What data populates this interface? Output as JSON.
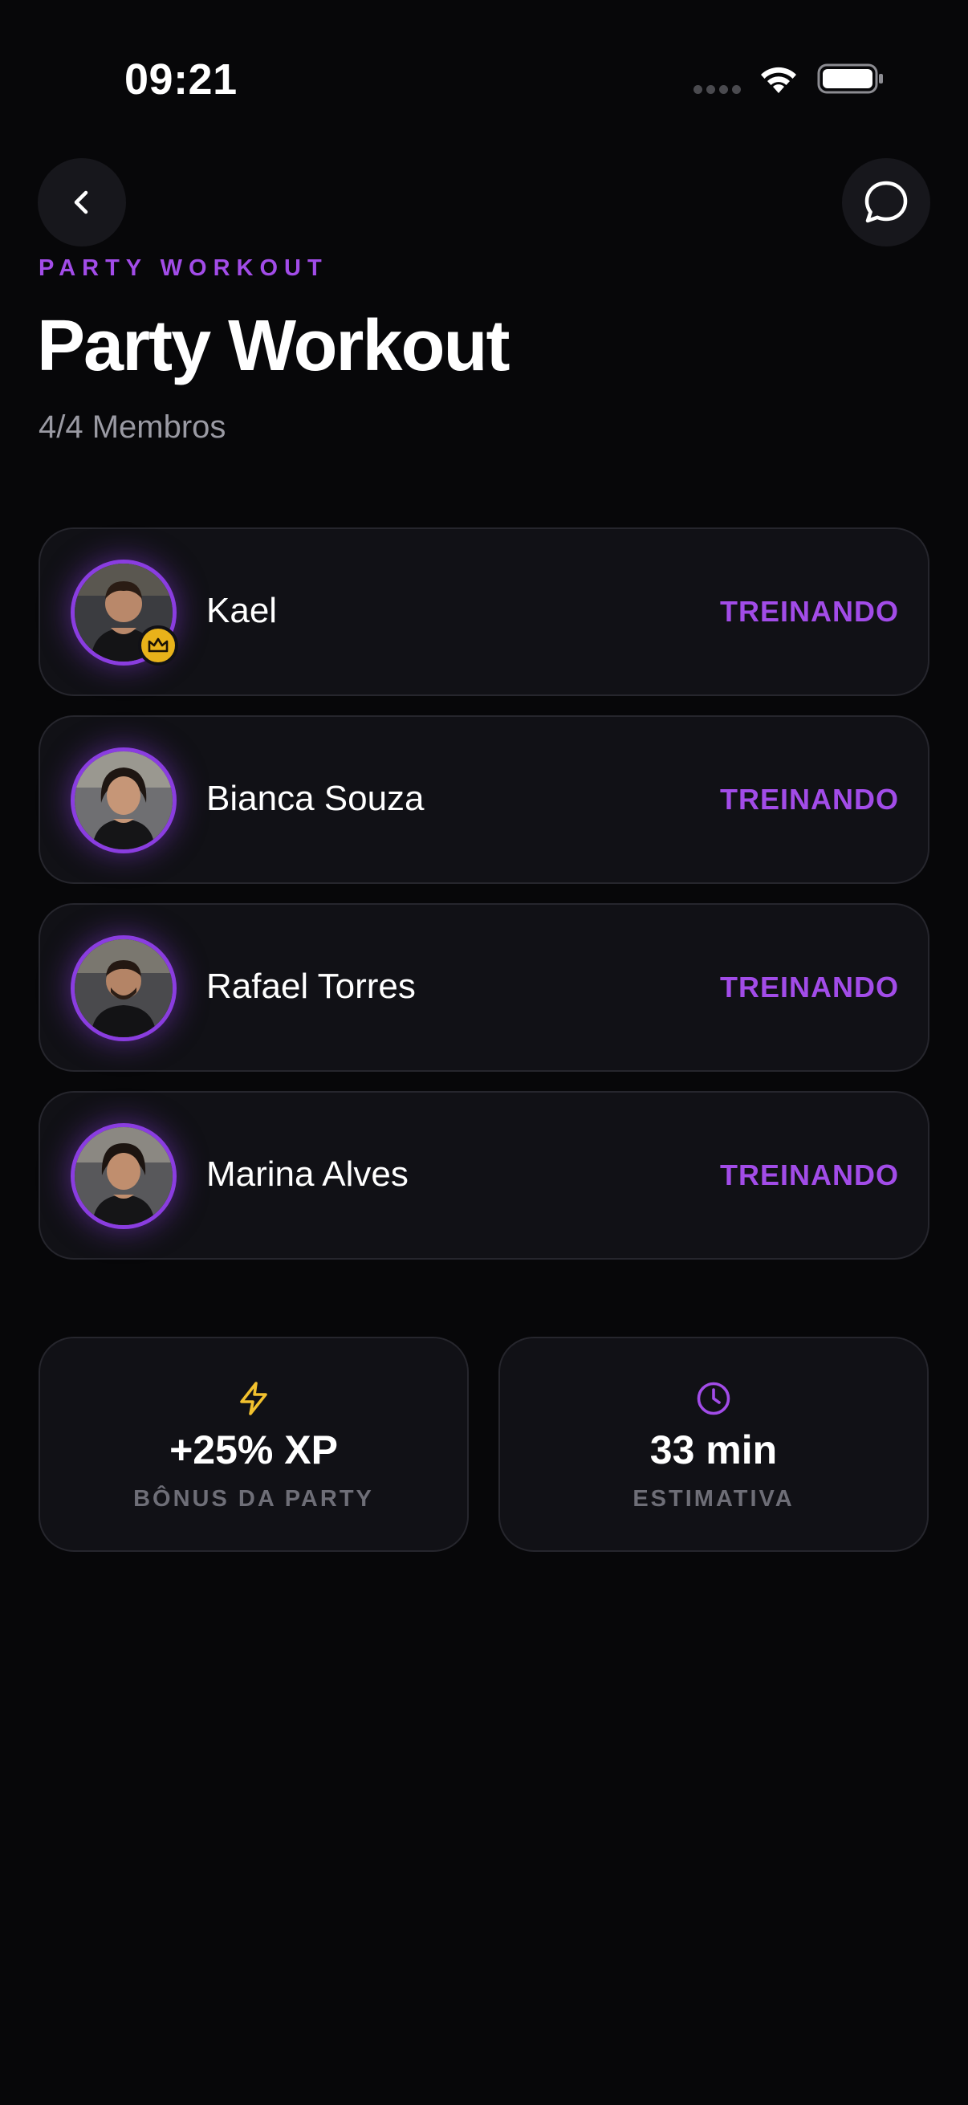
{
  "status_bar": {
    "time": "09:21",
    "icons": [
      "signal-icon",
      "wifi-icon",
      "battery-icon"
    ]
  },
  "header": {
    "back_icon": "chevron-left-icon",
    "chat_icon": "chat-bubble-icon",
    "eyebrow": "PARTY WORKOUT",
    "title": "Party Workout",
    "member_count": "4/4 Membros"
  },
  "members": [
    {
      "name": "Kael",
      "status": "TREINANDO",
      "leader": true,
      "badge_icon": "crown-icon"
    },
    {
      "name": "Bianca Souza",
      "status": "TREINANDO",
      "leader": false
    },
    {
      "name": "Rafael Torres",
      "status": "TREINANDO",
      "leader": false
    },
    {
      "name": "Marina Alves",
      "status": "TREINANDO",
      "leader": false
    }
  ],
  "stats": [
    {
      "icon": "lightning-icon",
      "value": "+25% XP",
      "label": "BÔNUS DA PARTY",
      "icon_color": "#f2c12e"
    },
    {
      "icon": "clock-icon",
      "value": "33 min",
      "label": "ESTIMATIVA",
      "icon_color": "#a24ce8"
    }
  ],
  "colors": {
    "background": "#070709",
    "card": "#111116",
    "accent": "#a24ce8",
    "gold": "#e8b21a"
  }
}
